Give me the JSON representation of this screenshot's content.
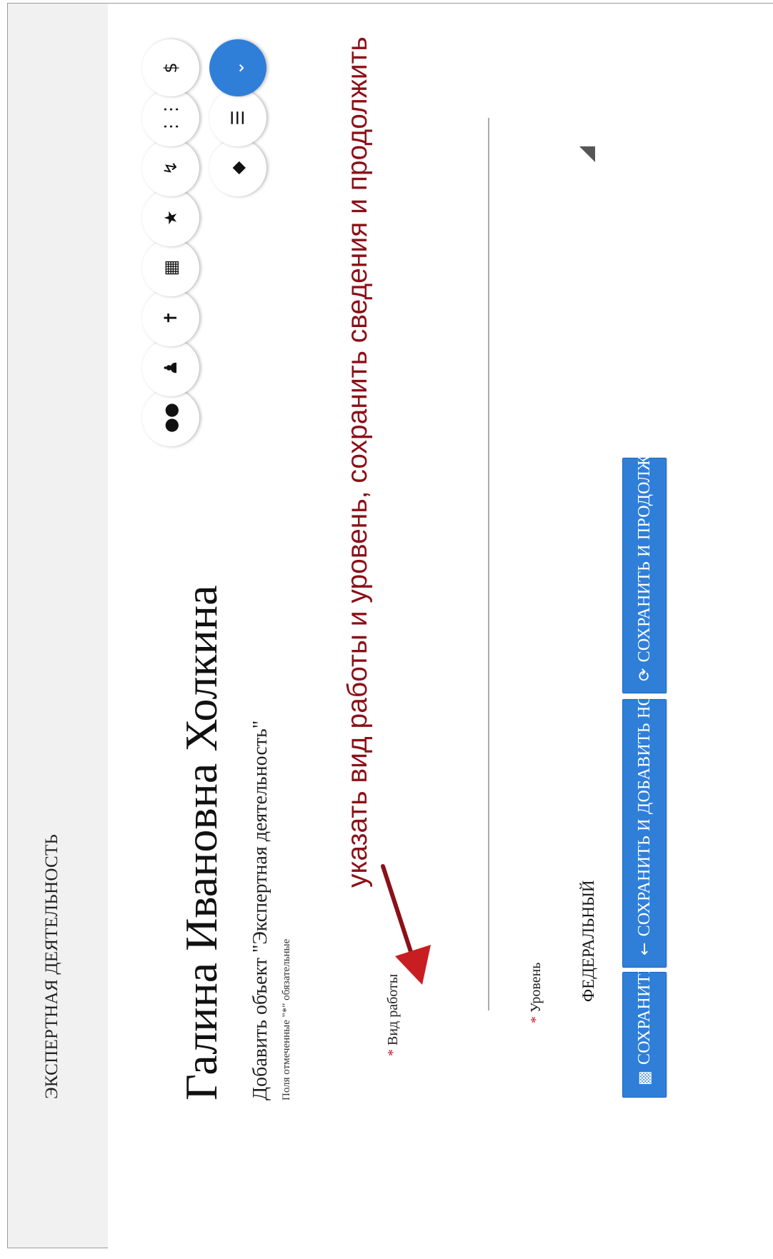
{
  "page": {
    "section_label": "ЭКСПЕРТНАЯ ДЕЯТЕЛЬНОСТЬ",
    "person_name": "Галина Ивановна Холкина",
    "subtitle": "Добавить объект \"Экспертная деятельность\"",
    "note": "Поля отмеченные \"*\" обязательные"
  },
  "annotation": {
    "hint": "указать вид работы и уровень, сохранить сведения и продолжить",
    "color": "#8b1018"
  },
  "form": {
    "required_mark": "*",
    "vid_raboty_label": "Вид работы",
    "vid_raboty_value": "",
    "level_label": "Уровень",
    "level_value": "ФЕДЕРАЛЬНЫЙ"
  },
  "buttons": {
    "save": "СОХРАНИТЬ",
    "save_and_add_new": "СОХРАНИТЬ И ДОБАВИТЬ НОВЫЙ",
    "save_and_continue": "СОХРАНИТЬ И ПРОДОЛЖИТЬ",
    "accent": "#2f7fd9"
  },
  "toolbar": {
    "icons": [
      "group-icon",
      "person-icon",
      "award-icon",
      "calendar-icon",
      "star-icon",
      "chart-icon",
      "list-icon",
      "dollar-icon"
    ],
    "secondary_icons": [
      "layers-icon",
      "list-up-icon",
      "chevron-down-icon"
    ]
  }
}
